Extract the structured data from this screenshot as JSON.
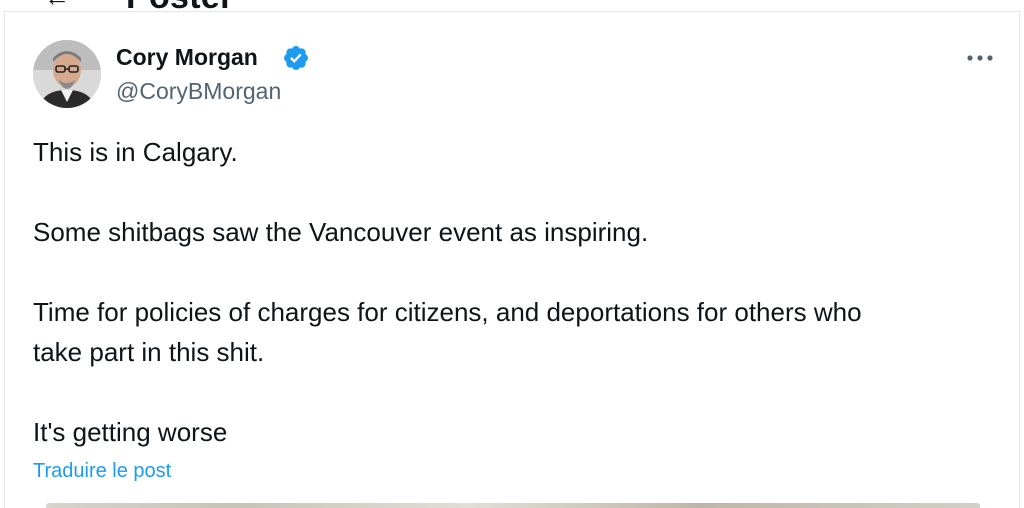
{
  "header": {
    "back_icon": "arrow-left-icon",
    "title": "Poster"
  },
  "post": {
    "author": {
      "name": "Cory Morgan",
      "handle": "@CoryBMorgan",
      "verified": true,
      "verified_color": "#1d9bf0"
    },
    "more_icon": "more-horizontal-icon",
    "text_lines": [
      "This is in Calgary.",
      "Some shitbags saw the Vancouver event as inspiring.",
      "Time for policies of charges for citizens, and deportations for others who",
      "take part in this shit.",
      "It's getting worse"
    ],
    "translate_label": "Traduire le post"
  },
  "colors": {
    "text": "#0f1419",
    "secondary": "#536471",
    "link": "#1d9bf0",
    "border": "#e6e6e6"
  }
}
